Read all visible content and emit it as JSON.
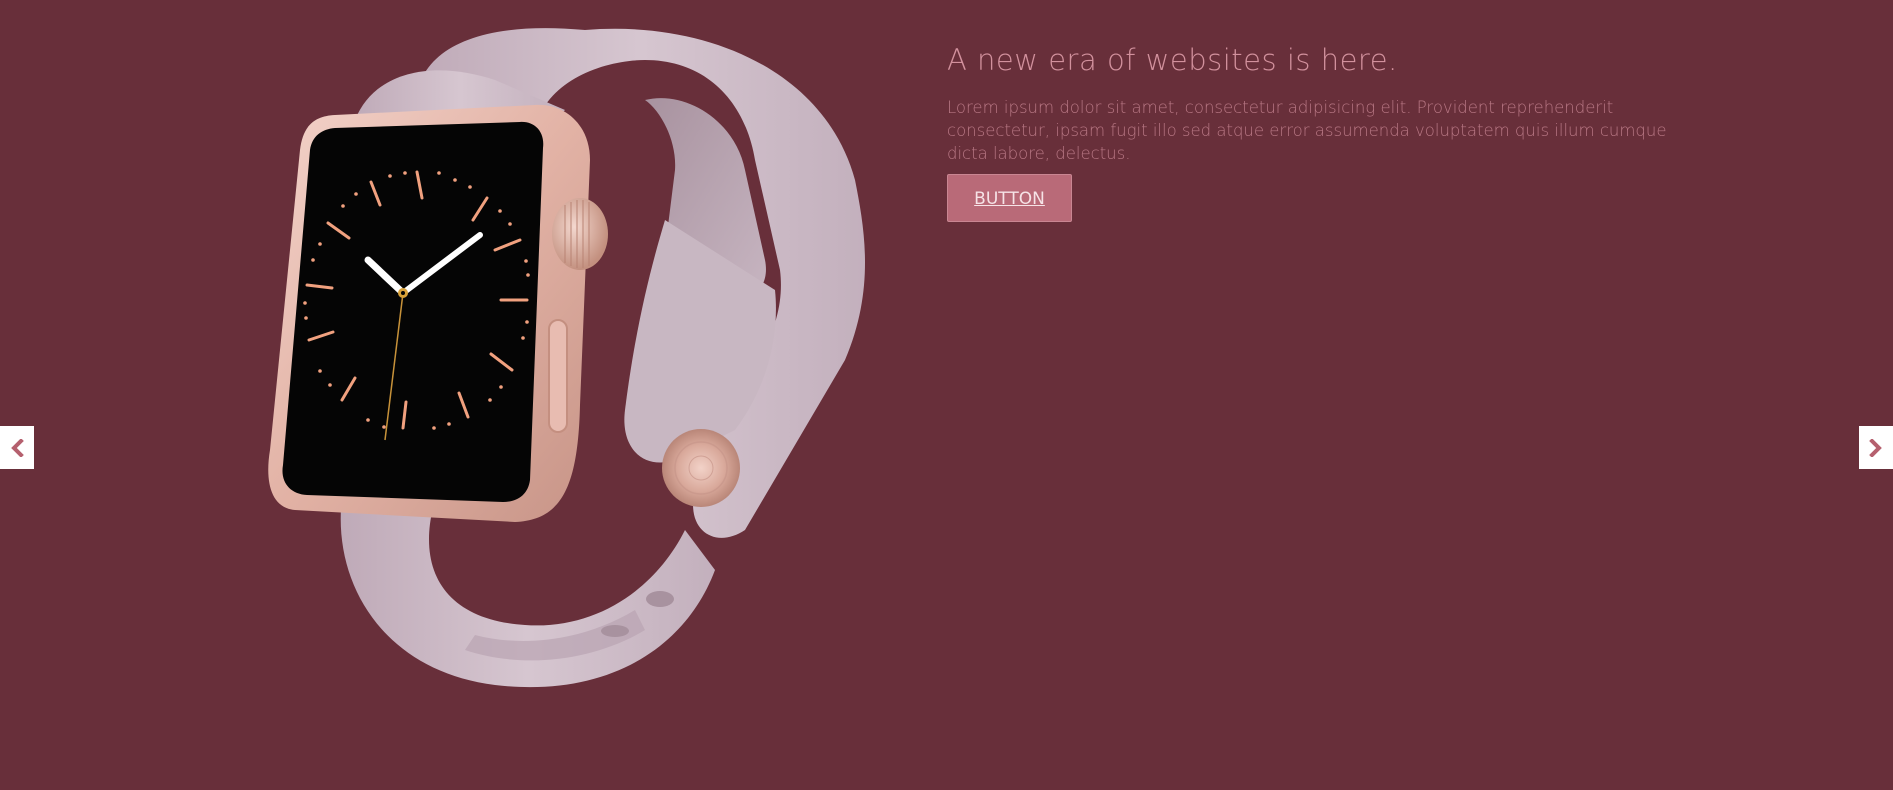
{
  "hero": {
    "headline": "A new era of websites is here.",
    "description": "Lorem ipsum dolor sit amet, consectetur adipisicing elit. Provident reprehenderit consectetur, ipsam fugit illo sed atque error assumenda voluptatem quis illum cumque dicta labore, delectus.",
    "button_label": "BUTTON"
  },
  "carousel": {
    "prev_icon": "chevron-left-icon",
    "next_icon": "chevron-right-icon"
  },
  "colors": {
    "background": "#682f3a",
    "headline": "#d2919d",
    "body_text": "#b87784",
    "button_bg": "#b96a78",
    "arrow_color": "#b5606e",
    "band": "#cdbac6",
    "watch_case": "#e8bcb1"
  }
}
